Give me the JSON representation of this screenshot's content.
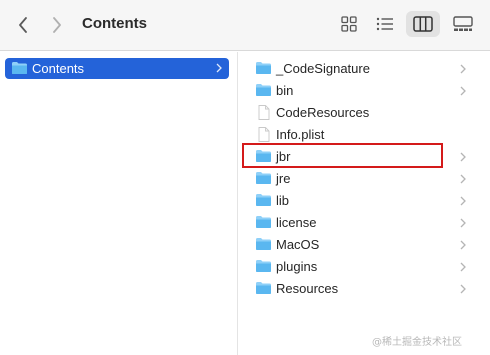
{
  "toolbar": {
    "title": "Contents",
    "back_icon": "chevron-left-icon",
    "forward_icon": "chevron-right-icon",
    "views": [
      "icons-view-icon",
      "list-view-icon",
      "column-view-icon",
      "gallery-view-icon"
    ],
    "selected_view": "column"
  },
  "sidebar": {
    "selected_item": "Contents",
    "selection_color": "#2463d9"
  },
  "files": [
    {
      "name": "_CodeSignature",
      "kind": "folder",
      "has_children": true
    },
    {
      "name": "bin",
      "kind": "folder",
      "has_children": true
    },
    {
      "name": "CodeResources",
      "kind": "file",
      "has_children": false
    },
    {
      "name": "Info.plist",
      "kind": "file",
      "has_children": false
    },
    {
      "name": "jbr",
      "kind": "folder",
      "has_children": true,
      "highlighted": true
    },
    {
      "name": "jre",
      "kind": "folder",
      "has_children": true
    },
    {
      "name": "lib",
      "kind": "folder",
      "has_children": true
    },
    {
      "name": "license",
      "kind": "folder",
      "has_children": true
    },
    {
      "name": "MacOS",
      "kind": "folder",
      "has_children": true
    },
    {
      "name": "plugins",
      "kind": "folder",
      "has_children": true
    },
    {
      "name": "Resources",
      "kind": "folder",
      "has_children": true
    }
  ],
  "highlight_color": "#d41a1a",
  "watermark": "@稀土掘金技术社区"
}
